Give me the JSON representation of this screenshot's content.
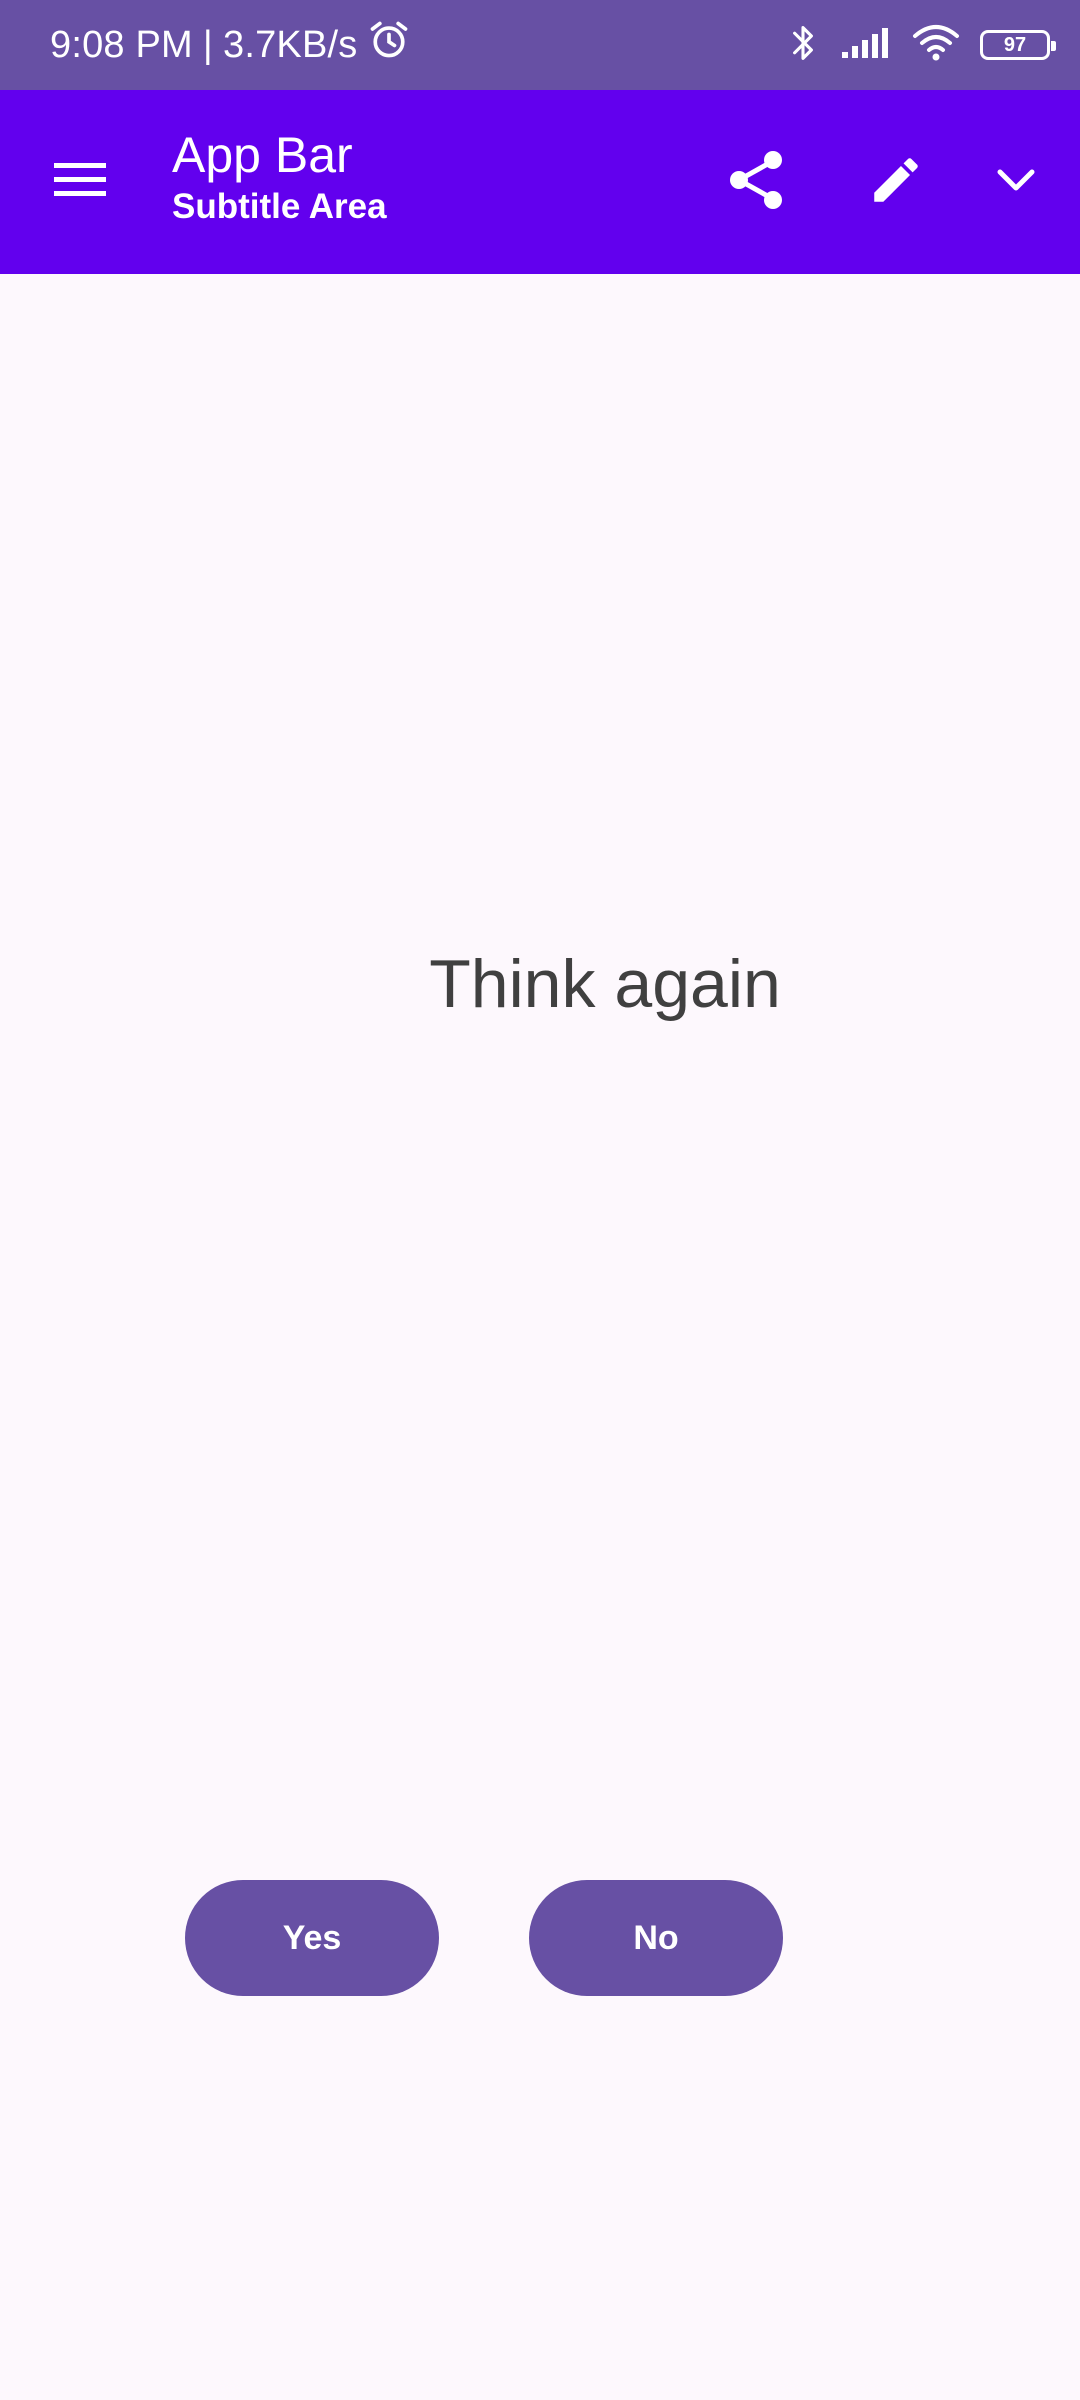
{
  "status_bar": {
    "time": "9:08 PM",
    "separator": "|",
    "network_speed": "3.7KB/s",
    "battery_level": "97",
    "icons": [
      "alarm-icon",
      "bluetooth-icon",
      "signal-icon",
      "wifi-icon",
      "battery-icon"
    ]
  },
  "app_bar": {
    "title": "App Bar",
    "subtitle": "Subtitle Area",
    "icons": [
      "menu-icon",
      "share-icon",
      "edit-icon",
      "chevron-down-icon"
    ]
  },
  "content": {
    "message": "Think again"
  },
  "actions": {
    "yes_label": "Yes",
    "no_label": "No"
  },
  "colors": {
    "status_bar_bg": "#6750A4",
    "app_bar_bg": "#6200EE",
    "button_bg": "#6750A4",
    "page_bg": "#FDF8FD",
    "text_dark": "#404040"
  }
}
